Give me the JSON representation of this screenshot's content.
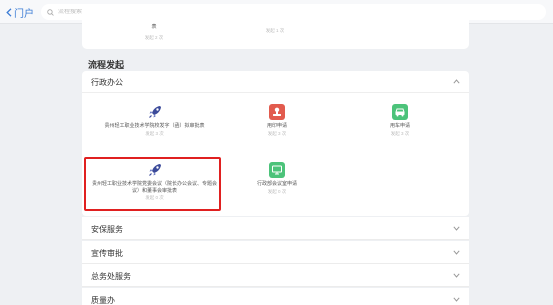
{
  "topbar": {
    "back_label": "门户",
    "search_placeholder": "流程搜索"
  },
  "previous": {
    "items": [
      {
        "name": "表",
        "count": "发起 2 次"
      },
      {
        "name": "",
        "count": "发起 1 次"
      }
    ]
  },
  "section_title": "流程发起",
  "category": {
    "name": "行政办公",
    "items": [
      {
        "name": "贵州轻工职业技术学院校发字（函）拟审批表",
        "count": "发起 3 次",
        "icon": "rocket-icon",
        "color": "#3b4a9a"
      },
      {
        "name": "用印申请",
        "count": "发起 3 次",
        "icon": "stamp-icon",
        "color": "#e25b4e"
      },
      {
        "name": "用车申请",
        "count": "发起 3 次",
        "icon": "car-icon",
        "color": "#4cc37a"
      },
      {
        "name": "贵州轻工职业技术学院党委会议（院长办公会议、专题会议）和董事会审批表",
        "count": "发起 0 次",
        "icon": "rocket-icon",
        "color": "#3b4a9a"
      },
      {
        "name": "行政部会议室申请",
        "count": "发起 0 次",
        "icon": "meeting-icon",
        "color": "#4cc37a"
      }
    ]
  },
  "collapsed_categories": [
    {
      "name": "安保服务"
    },
    {
      "name": "宣传审批"
    },
    {
      "name": "总务处服务"
    },
    {
      "name": "质量办"
    }
  ]
}
